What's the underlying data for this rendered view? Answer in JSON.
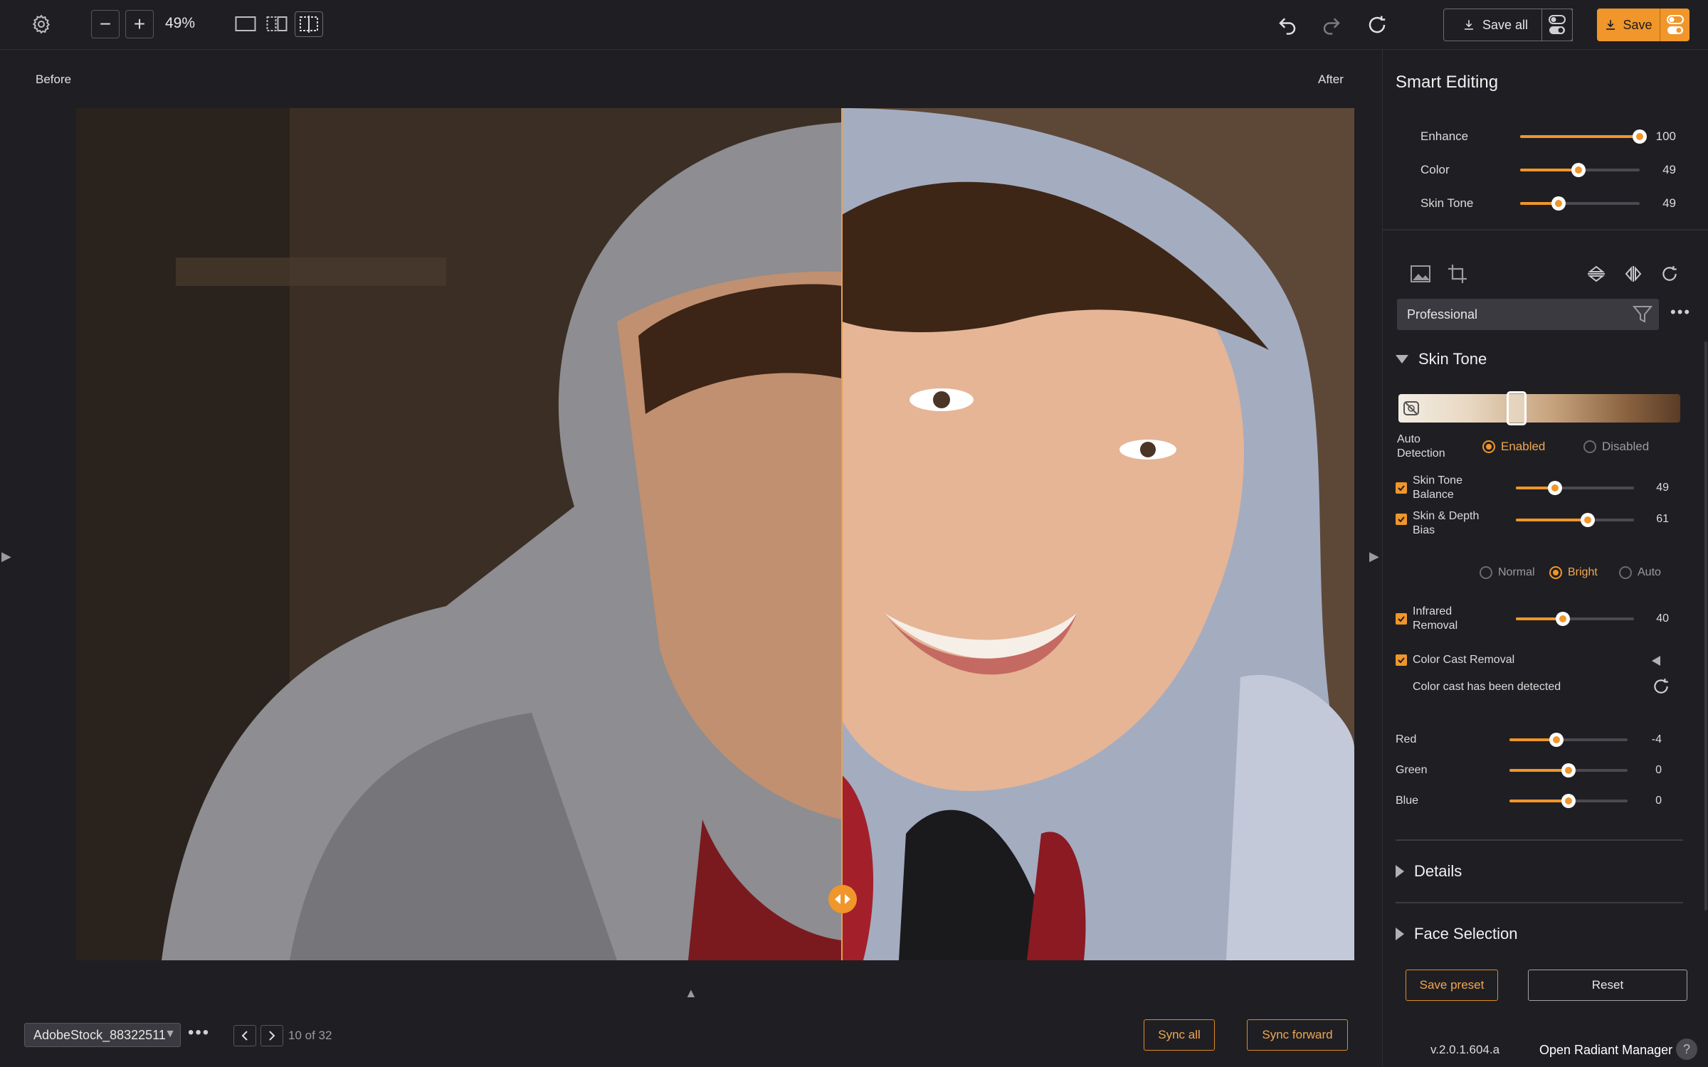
{
  "toolbar": {
    "zoom_value": "49%",
    "save_all_label": "Save all",
    "save_label": "Save"
  },
  "canvas": {
    "before_label": "Before",
    "after_label": "After"
  },
  "bottom": {
    "file_name": "AdobeStock_88322511",
    "page_count": "10 of 32",
    "sync_all_label": "Sync all",
    "sync_forward_label": "Sync forward"
  },
  "panel": {
    "title": "Smart Editing",
    "sliders": [
      {
        "label": "Enhance",
        "value": "100",
        "level": 1.0
      },
      {
        "label": "Color",
        "value": "49",
        "level": 0.49
      },
      {
        "label": "Skin Tone",
        "value": "49",
        "level": 0.32
      }
    ],
    "preset": "Professional",
    "skin_tone": {
      "title": "Skin Tone",
      "tone_level": 0.42,
      "auto_detection_label_1": "Auto",
      "auto_detection_label_2": "Detection",
      "enabled_label": "Enabled",
      "disabled_label": "Disabled",
      "balance_label_1": "Skin Tone",
      "balance_label_2": "Balance",
      "balance_value": "49",
      "balance_level": 0.33,
      "depth_label_1": "Skin & Depth",
      "depth_label_2": "Bias",
      "depth_value": "61",
      "depth_level": 0.61,
      "mode_normal": "Normal",
      "mode_bright": "Bright",
      "mode_auto": "Auto",
      "infrared_label_1": "Infrared",
      "infrared_label_2": "Removal",
      "infrared_value": "40",
      "infrared_level": 0.4,
      "color_cast_label": "Color Cast Removal",
      "color_cast_detected": "Color cast has been detected",
      "rgb": [
        {
          "label": "Red",
          "value": "-4",
          "level": 0.4
        },
        {
          "label": "Green",
          "value": "0",
          "level": 0.5
        },
        {
          "label": "Blue",
          "value": "0",
          "level": 0.5
        }
      ]
    },
    "details_title": "Details",
    "face_selection_title": "Face Selection",
    "save_preset_label": "Save preset",
    "reset_label": "Reset",
    "version": "v.2.0.1.604.a",
    "open_radiant_label": "Open Radiant Manager",
    "help_label": "?"
  },
  "colors": {
    "accent": "#f0962a",
    "background": "#1f1f23"
  }
}
